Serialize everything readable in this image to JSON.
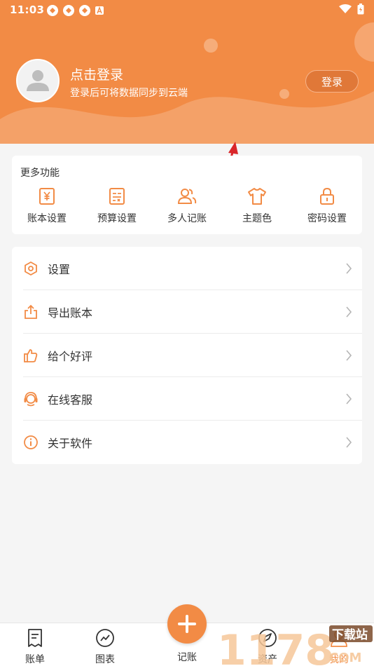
{
  "status_bar": {
    "time": "11:03"
  },
  "header": {
    "login_title": "点击登录",
    "login_subtitle": "登录后可将数据同步到云端",
    "login_button": "登录"
  },
  "features": {
    "title": "更多功能",
    "items": [
      {
        "label": "账本设置",
        "icon": "ledger-yen-icon"
      },
      {
        "label": "预算设置",
        "icon": "budget-icon"
      },
      {
        "label": "多人记账",
        "icon": "multi-user-icon"
      },
      {
        "label": "主题色",
        "icon": "shirt-icon"
      },
      {
        "label": "密码设置",
        "icon": "lock-icon"
      }
    ]
  },
  "menu": {
    "items": [
      {
        "label": "设置",
        "icon": "hexagon-gear-icon"
      },
      {
        "label": "导出账本",
        "icon": "export-icon"
      },
      {
        "label": "给个好评",
        "icon": "thumbs-up-icon"
      },
      {
        "label": "在线客服",
        "icon": "headset-icon"
      },
      {
        "label": "关于软件",
        "icon": "info-icon"
      }
    ]
  },
  "bottom_nav": {
    "items": [
      {
        "label": "账单",
        "icon": "receipt-icon"
      },
      {
        "label": "图表",
        "icon": "chart-icon"
      },
      {
        "label": "记账",
        "icon": "plus-icon"
      },
      {
        "label": "资产",
        "icon": "compass-icon"
      },
      {
        "label": "我的",
        "icon": "user-icon"
      }
    ]
  },
  "watermark": {
    "number": "1178",
    "text": "下载站",
    "suffix": "COM"
  },
  "colors": {
    "accent": "#f28b45",
    "accent_dark": "#e07838",
    "background": "#f5f5f5"
  }
}
